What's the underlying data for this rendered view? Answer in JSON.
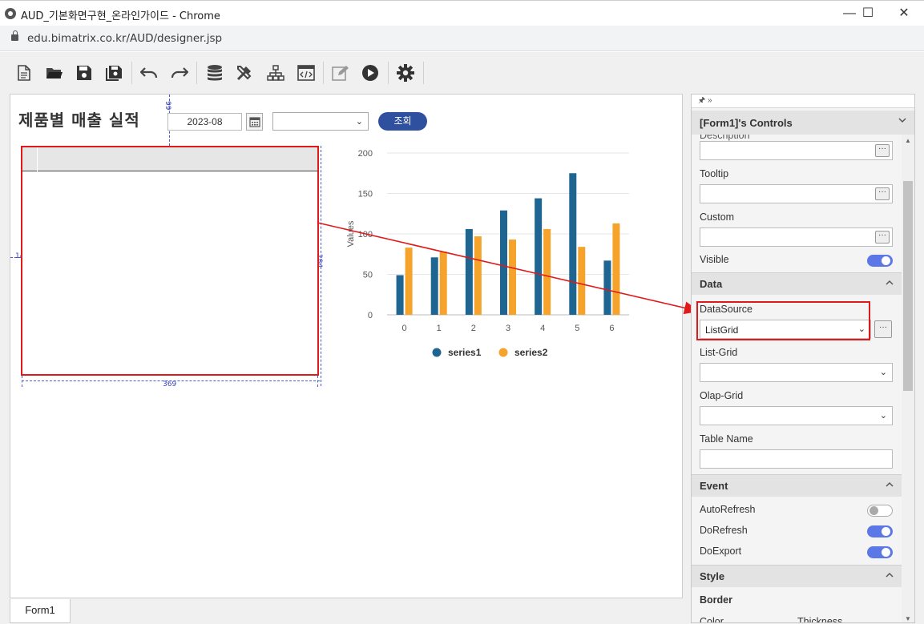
{
  "window": {
    "title": "AUD_기본화면구현_온라인가이드 - Chrome",
    "url": "edu.bimatrix.co.kr/AUD/designer.jsp",
    "minimize": "—",
    "maximize": "☐",
    "close": "✕"
  },
  "toolbar": {
    "buttons": [
      "new-document-icon",
      "open-folder-icon",
      "save-icon",
      "save-all-icon",
      "undo-icon",
      "redo-icon",
      "database-icon",
      "tools-icon",
      "hierarchy-icon",
      "code-view-icon",
      "edit-icon",
      "run-icon",
      "settings-icon"
    ]
  },
  "form": {
    "title": "제품별 매출 실적",
    "date_value": "2023-08",
    "combo_value": "",
    "query_button": "조회",
    "tab_label": "Form1",
    "dims": {
      "top": "99",
      "left": "14",
      "right": "284",
      "bottom": "369"
    }
  },
  "chart_data": {
    "type": "bar",
    "categories": [
      "0",
      "1",
      "2",
      "3",
      "4",
      "5",
      "6"
    ],
    "series": [
      {
        "name": "series1",
        "color": "#1f6591",
        "values": [
          49,
          71,
          106,
          129,
          144,
          175,
          67
        ]
      },
      {
        "name": "series2",
        "color": "#f5a32a",
        "values": [
          83,
          78,
          97,
          93,
          106,
          84,
          113
        ]
      }
    ],
    "ylabel": "Values",
    "ylim": [
      0,
      200
    ],
    "yticks": [
      "0",
      "50",
      "100",
      "150",
      "200"
    ],
    "grid": true,
    "legend": "bottom"
  },
  "panel": {
    "header": "[Form1]'s Controls",
    "pin": "🖈 »",
    "fields": {
      "description": "Description",
      "tooltip": "Tooltip",
      "custom": "Custom",
      "visible": "Visible"
    },
    "data_section": "Data",
    "datasource_label": "DataSource",
    "datasource_value": "ListGrid",
    "listgrid_label": "List-Grid",
    "olapgrid_label": "Olap-Grid",
    "tablename_label": "Table Name",
    "event_section": "Event",
    "autorefresh": "AutoRefresh",
    "dorefresh": "DoRefresh",
    "doexport": "DoExport",
    "style_section": "Style",
    "border_label": "Border",
    "color_label": "Color",
    "thickness_label": "Thickness",
    "ellipsis": "···"
  }
}
